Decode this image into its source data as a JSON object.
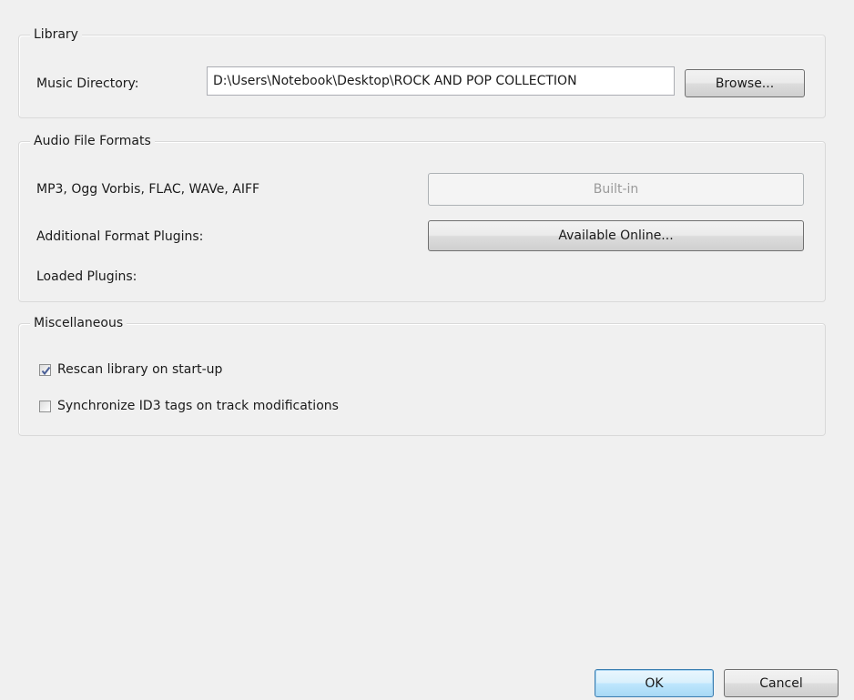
{
  "library": {
    "title": "Library",
    "music_directory_label": "Music Directory:",
    "music_directory_value": "D:\\Users\\Notebook\\Desktop\\ROCK AND POP COLLECTION",
    "browse_label": "Browse..."
  },
  "audio_formats": {
    "title": "Audio File Formats",
    "builtin_formats_label": "MP3, Ogg Vorbis, FLAC, WAVe, AIFF",
    "builtin_button_label": "Built-in",
    "additional_plugins_label": "Additional Format Plugins:",
    "available_online_label": "Available Online...",
    "loaded_plugins_label": "Loaded Plugins:"
  },
  "misc": {
    "title": "Miscellaneous",
    "rescan_label": "Rescan library on start-up",
    "rescan_checked": true,
    "sync_id3_label": "Synchronize ID3 tags on track modifications",
    "sync_id3_checked": false
  },
  "footer": {
    "ok_label": "OK",
    "cancel_label": "Cancel"
  },
  "colors": {
    "window_bg": "#f0f0f0",
    "check_mark": "#4a5f97",
    "default_button_border": "#3c7fb1"
  }
}
